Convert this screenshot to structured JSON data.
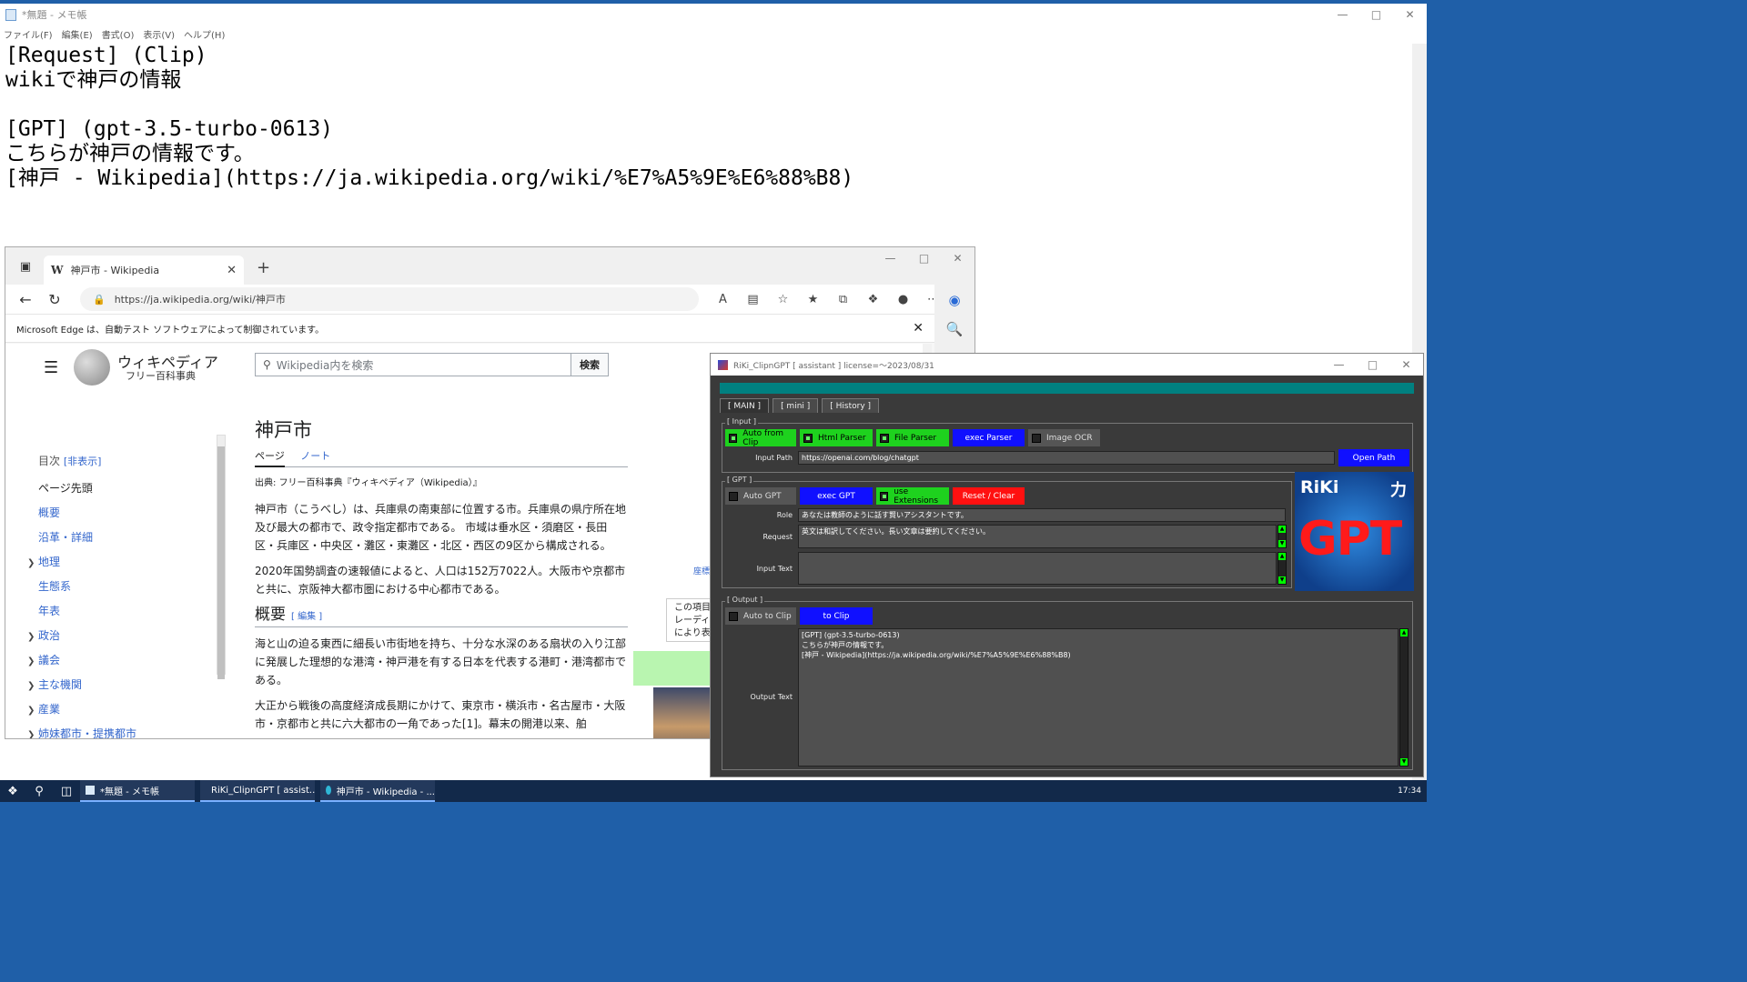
{
  "notepad": {
    "title": "*無題 - メモ帳",
    "menu": [
      "ファイル(F)",
      "編集(E)",
      "書式(O)",
      "表示(V)",
      "ヘルプ(H)"
    ],
    "content": "[Request] (Clip)\nwikiで神戸の情報\n\n[GPT] (gpt-3.5-turbo-0613)\nこちらが神戸の情報です。\n[神戸 - Wikipedia](https://ja.wikipedia.org/wiki/%E7%A5%9E%E6%88%B8)"
  },
  "edge": {
    "tab_title": "神戸市 - Wikipedia",
    "url": "https://ja.wikipedia.org/wiki/神戸市",
    "infobar": "Microsoft Edge は、自動テスト ソフトウェアによって制御されています。",
    "wiki": {
      "site_name": "ウィキペディア",
      "site_sub": "フリー百科事典",
      "search_placeholder": "Wikipedia内を検索",
      "search_button": "検索",
      "toc_title": "目次",
      "toc_hide": "[非表示]",
      "toc": [
        "ページ先頭",
        "概要",
        "沿革・詳細",
        "地理",
        "生態系",
        "年表",
        "政治",
        "議会",
        "主な機関",
        "産業",
        "姉妹都市・提携都市"
      ],
      "title": "神戸市",
      "tab_page": "ページ",
      "tab_note": "ノート",
      "from": "出典: フリー百科事典『ウィキペディア（Wikipedia）』",
      "coord": "座標",
      "para1": "神戸市（こうべし）は、兵庫県の南東部に位置する市。兵庫県の県庁所在地及び最大の都市で、政令指定都市である。 市域は垂水区・須磨区・長田区・兵庫区・中央区・灘区・東灘区・北区・西区の9区から構成される。",
      "para2": "2020年国勢調査の速報値によると、人口は152万7022人。大阪市や京都市と共に、京阪神大都市圏における中心都市である。",
      "h2": "概要",
      "h2_edit": "[ 編集 ]",
      "para3": "海と山の迫る東西に細長い市街地を持ち、十分な水深のある扇状の入り江部に発展した理想的な港湾・神戸港を有する日本を代表する港町・港湾都市である。",
      "para4": "大正から戦後の高度経済成長期にかけて、東京市・横浜市・名古屋市・大阪市・京都市と共に六大都市の一角であった[1]。幕末の開港以来、舶",
      "infobox_note": "この項目 レーディ により表"
    }
  },
  "riki": {
    "title": "RiKi_ClipnGPT [ assistant ] license=～2023/08/31",
    "tabs": [
      "[ MAIN ]",
      "[ mini ]",
      "[ History ]"
    ],
    "input_label": "[ Input ]",
    "btn_auto_clip": "Auto from Clip",
    "btn_html": "Html Parser",
    "btn_file": "File Parser",
    "btn_exec_parser": "exec Parser",
    "btn_ocr": "Image OCR",
    "input_path_label": "Input Path",
    "input_path": "https://openai.com/blog/chatgpt",
    "btn_open_path": "Open Path",
    "gpt_label": "[ GPT ]",
    "btn_auto_gpt": "Auto GPT",
    "btn_exec_gpt": "exec GPT",
    "btn_use_ext": "use Extensions",
    "btn_reset": "Reset / Clear",
    "role_label": "Role",
    "role_value": "あなたは教師のように話す賢いアシスタントです。",
    "request_label": "Request",
    "request_value": "英文は和訳してください。長い文章は要約してください。",
    "input_text_label": "Input Text",
    "input_text_value": "",
    "logo_left": "RiKi",
    "logo_right": "力",
    "logo_main": "GPT",
    "output_label": "[ Output ]",
    "btn_auto_to_clip": "Auto to Clip",
    "btn_to_clip": "to Clip",
    "output_text_label": "Output Text",
    "output_value": "[GPT] (gpt-3.5-turbo-0613)\nこちらが神戸の情報です。\n[神戸 - Wikipedia](https://ja.wikipedia.org/wiki/%E7%A5%9E%E6%88%B8)"
  },
  "taskbar": {
    "apps": [
      "*無題 - メモ帳",
      "RiKi_ClipnGPT [ assist...",
      "神戸市 - Wikipedia - ..."
    ],
    "clock": "17:34"
  }
}
